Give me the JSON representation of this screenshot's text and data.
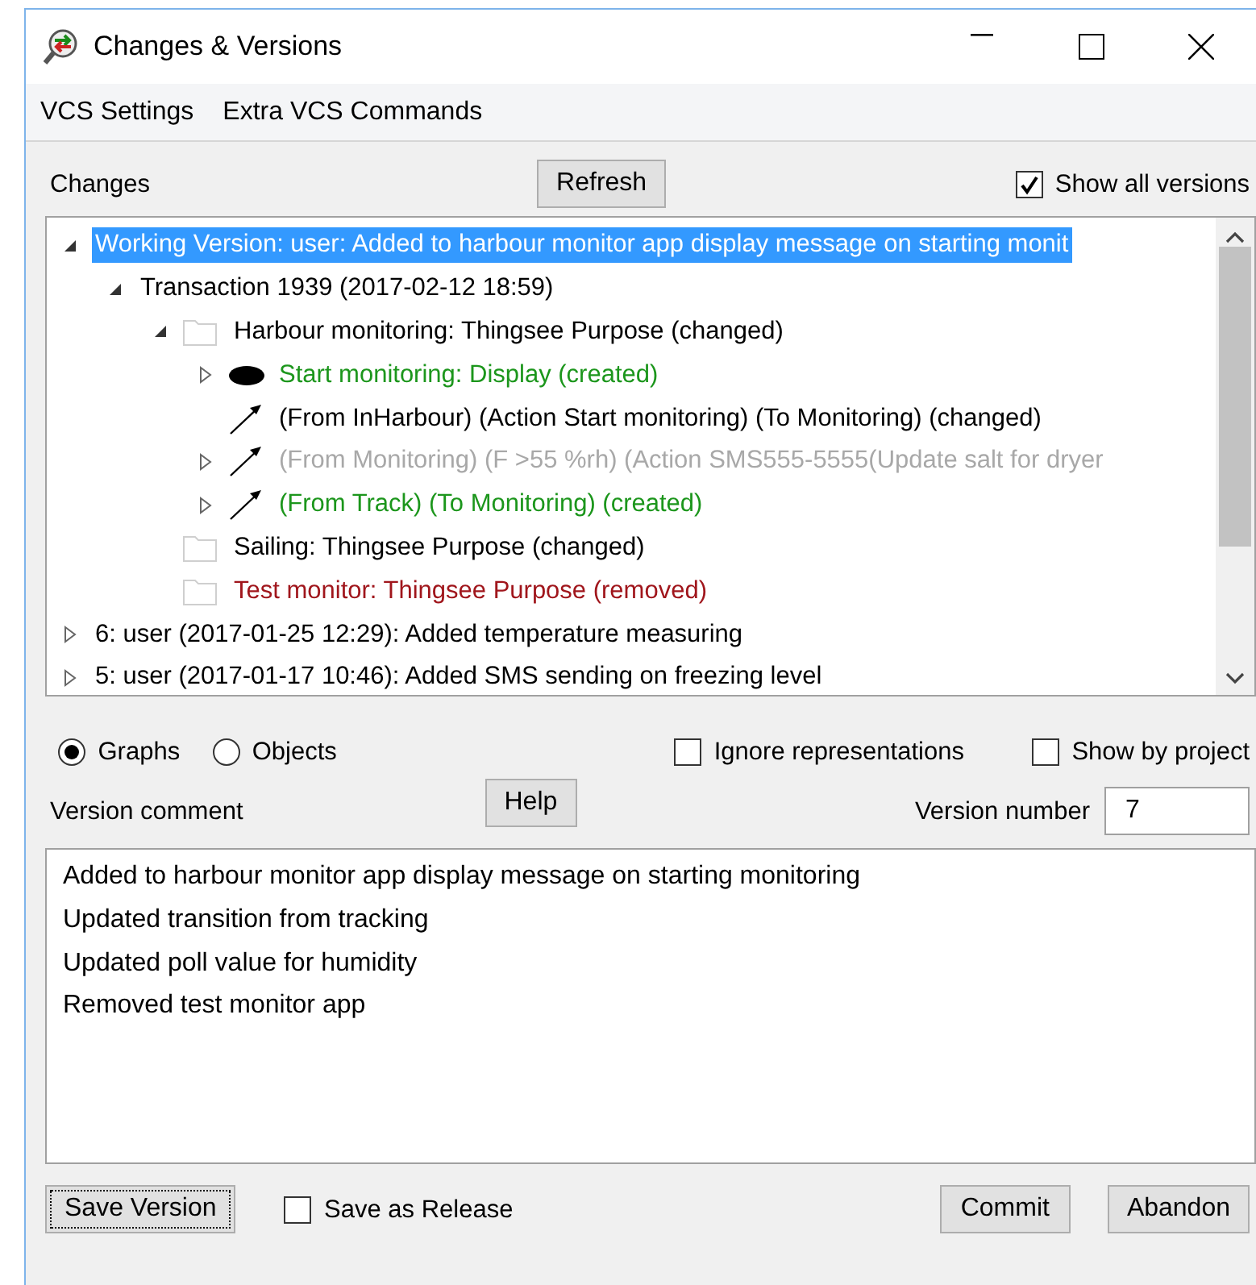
{
  "window": {
    "title": "Changes & Versions"
  },
  "menu": [
    "VCS Settings",
    "Extra VCS Commands"
  ],
  "changes": {
    "label": "Changes",
    "refresh_button": "Refresh",
    "show_all_versions": {
      "label": "Show all versions",
      "checked": true
    }
  },
  "tree": [
    {
      "label": "Working Version: user: Added to harbour monitor app display message on starting monit",
      "expanded": true,
      "selected": true,
      "children": [
        {
          "label": "Transaction 1939 (2017-02-12 18:59)",
          "expanded": true,
          "color": "#000000",
          "selected": false,
          "children": [
            {
              "kind": "folder",
              "label": "Harbour monitoring: Thingsee Purpose (changed)",
              "expanded": true,
              "color": "#000000",
              "selected": false,
              "children": [
                {
                  "kind": "node",
                  "label": "Start monitoring: Display (created)",
                  "expanded": false,
                  "color": "#1c961c",
                  "selected": false
                },
                {
                  "kind": "transition",
                  "label": "(From InHarbour) (Action Start monitoring) (To Monitoring) (changed)",
                  "color": "#000000",
                  "selected": false
                },
                {
                  "kind": "transition",
                  "label": "(From Monitoring) (F >55 %rh) (Action SMS555-5555(Update salt for dryer",
                  "expanded": false,
                  "color": "#a8a8a8",
                  "selected": false
                },
                {
                  "kind": "transition",
                  "label": "(From Track) (To Monitoring) (created)",
                  "expanded": false,
                  "color": "#1c961c",
                  "selected": false
                }
              ]
            },
            {
              "kind": "folder",
              "label": "Sailing: Thingsee Purpose (changed)",
              "color": "#000000",
              "selected": false
            },
            {
              "kind": "folder",
              "label": "Test monitor: Thingsee Purpose (removed)",
              "color": "#a0161c",
              "selected": false
            }
          ]
        }
      ]
    },
    {
      "label": "6: user (2017-01-25 12:29): Added temperature measuring",
      "expanded": false,
      "color": "#000000",
      "selected": false
    },
    {
      "label": "5: user (2017-01-17 10:46): Added SMS sending on freezing level",
      "expanded": false,
      "color": "#000000",
      "selected": false
    }
  ],
  "view_mode": [
    {
      "label": "Graphs",
      "selected": true
    },
    {
      "label": "Objects",
      "selected": false
    }
  ],
  "options": [
    {
      "label": "Ignore representations",
      "checked": false
    },
    {
      "label": "Show by project",
      "checked": false
    }
  ],
  "version_comment": {
    "label": "Version comment",
    "help_button": "Help",
    "lines": [
      "Added to harbour monitor app display message on starting monitoring",
      "Updated transition from tracking",
      "Updated poll value for humidity",
      "Removed test monitor app"
    ]
  },
  "version_number": {
    "label": "Version number",
    "value": "7"
  },
  "footer": {
    "save_version": "Save Version",
    "save_as_release": {
      "label": "Save as Release",
      "checked": false
    },
    "commit": "Commit",
    "abandon": "Abandon"
  }
}
